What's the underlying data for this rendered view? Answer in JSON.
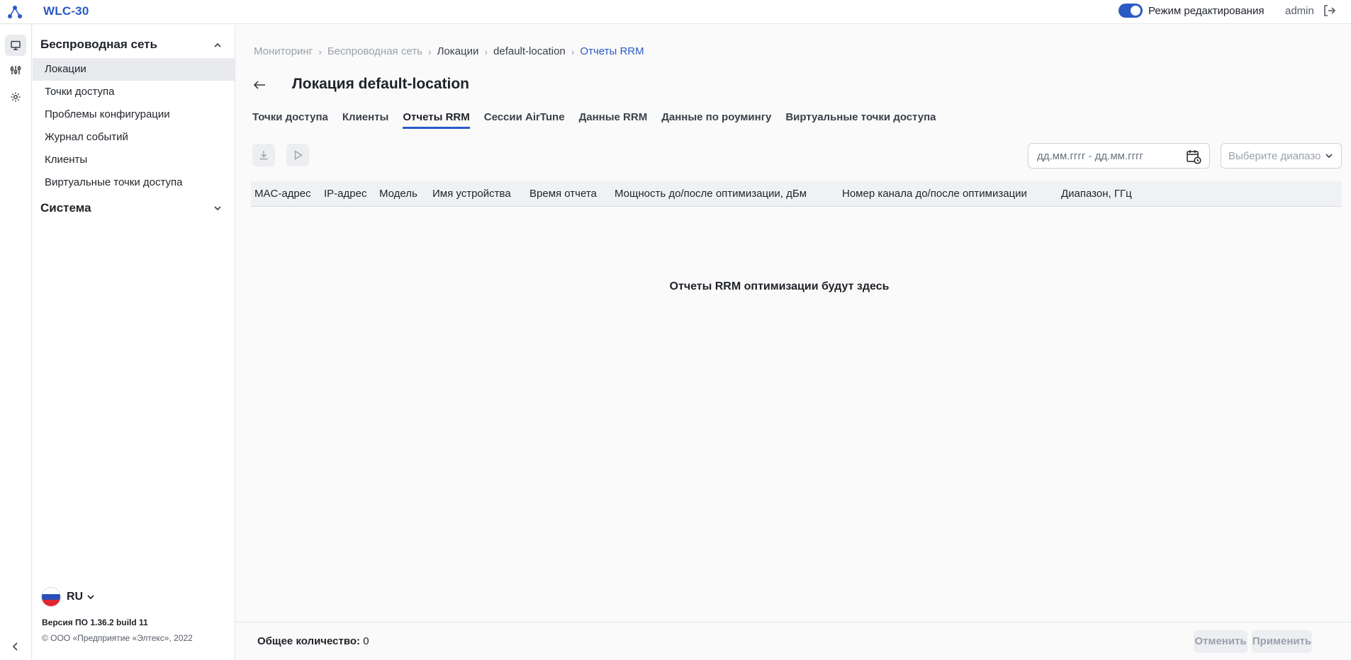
{
  "app": {
    "title": "WLC-30"
  },
  "header": {
    "edit_mode_label": "Режим редактирования",
    "user": "admin"
  },
  "sidebar": {
    "section_wireless": "Беспроводная сеть",
    "items": [
      "Локации",
      "Точки доступа",
      "Проблемы конфигурации",
      "Журнал событий",
      "Клиенты",
      "Виртуальные точки доступа"
    ],
    "section_system": "Система",
    "language": "RU",
    "version": "Версия ПО 1.36.2 build 11",
    "copyright": "© ООО «Предприятие «Элтекс», 2022"
  },
  "breadcrumb": [
    "Мониторинг",
    "Беспроводная сеть",
    "Локации",
    "default-location",
    "Отчеты RRM"
  ],
  "page": {
    "title": "Локация default-location"
  },
  "tabs": [
    "Точки доступа",
    "Клиенты",
    "Отчеты RRM",
    "Сессии AirTune",
    "Данные RRM",
    "Данные по роумингу",
    "Виртуальные точки доступа"
  ],
  "filters": {
    "date_placeholder": "дд.мм.гггг - дд.мм.гггг",
    "range_placeholder": "Выберите диапазон"
  },
  "table": {
    "columns": [
      "MAC-адрес",
      "IP-адрес",
      "Модель",
      "Имя устройства",
      "Время отчета",
      "Мощность до/после оптимизации, дБм",
      "Номер канала до/после оптимизации",
      "Диапазон, ГГц"
    ],
    "empty_message": "Отчеты RRM оптимизации будут здесь"
  },
  "footer": {
    "total_label": "Общее количество:",
    "total_value": "0",
    "cancel_label": "Отменить",
    "apply_label": "Применить"
  },
  "colors": {
    "accent": "#2a5bc4"
  }
}
